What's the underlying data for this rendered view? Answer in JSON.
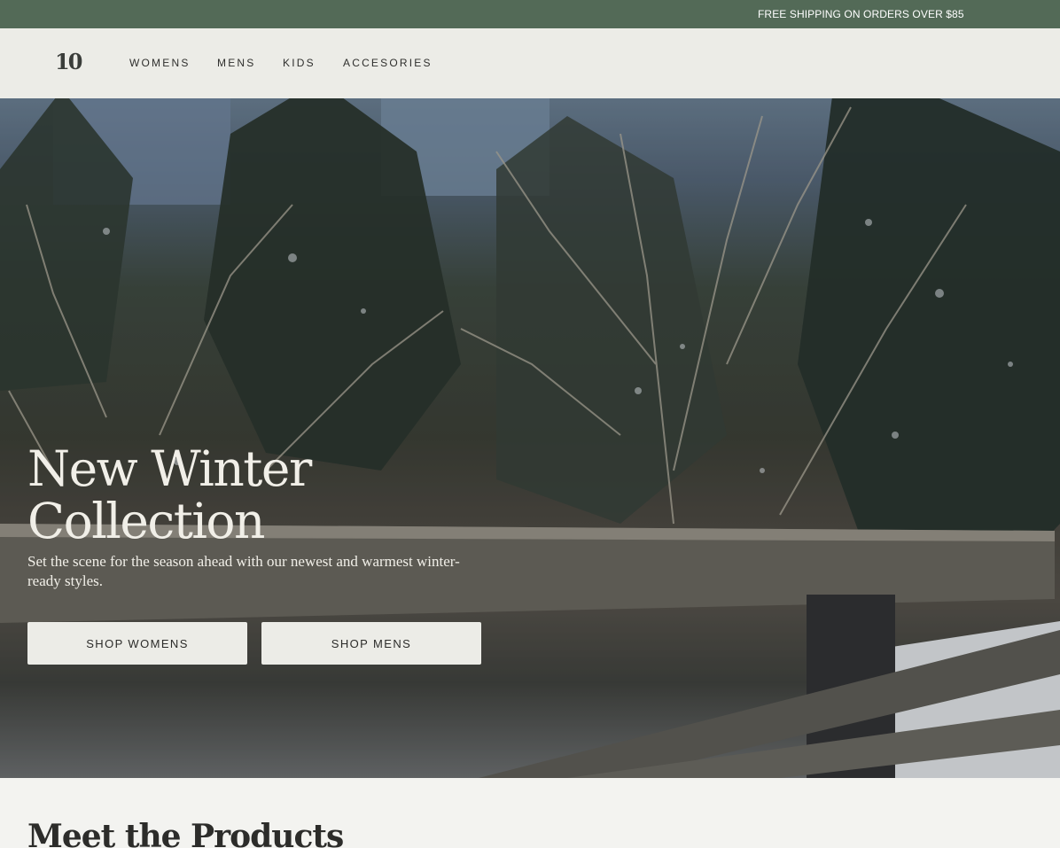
{
  "promo": {
    "text": "FREE SHIPPING ON ORDERS OVER $85"
  },
  "header": {
    "logo_text": "10",
    "nav": [
      {
        "label": "WOMENS"
      },
      {
        "label": "MENS"
      },
      {
        "label": "KIDS"
      },
      {
        "label": "ACCESORIES"
      }
    ]
  },
  "hero": {
    "title_line1": "New Winter",
    "title_line2": "Collection",
    "subtitle": "Set the scene for the season ahead with our newest and warmest winter-ready styles.",
    "buttons": [
      {
        "label": "SHOP WOMENS"
      },
      {
        "label": "SHOP MENS"
      }
    ]
  },
  "products": {
    "heading": "Meet the Products"
  },
  "colors": {
    "promo_bg": "#536a57",
    "header_bg": "#ecece7",
    "button_bg": "#ecece7",
    "page_bg": "#f3f3f0"
  }
}
